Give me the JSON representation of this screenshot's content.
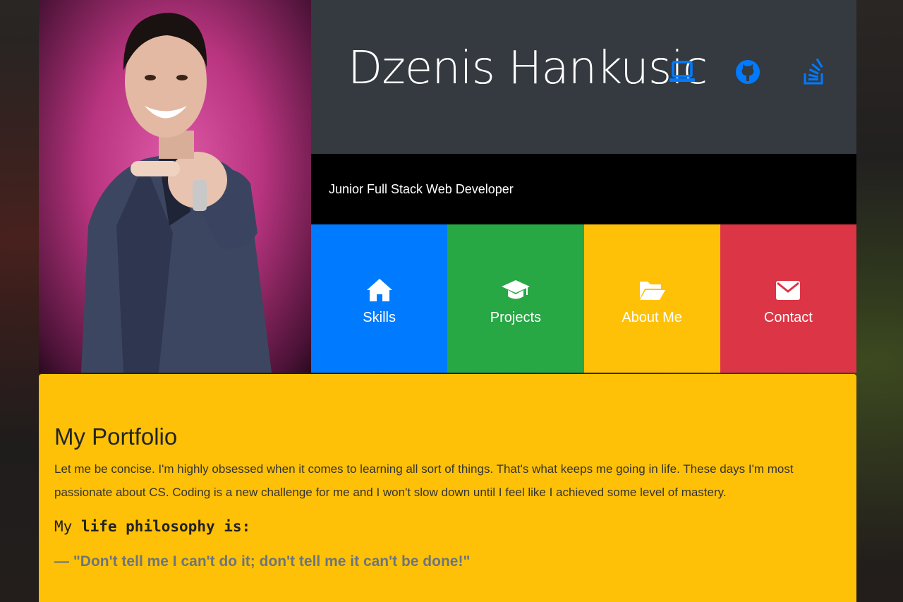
{
  "header": {
    "name": "Dzenis Hankusic",
    "subtitle": "Junior Full Stack Web Developer",
    "social": [
      {
        "icon": "laptop-icon"
      },
      {
        "icon": "github-icon"
      },
      {
        "icon": "stackoverflow-icon"
      }
    ],
    "social_color": "#007bff"
  },
  "nav": {
    "tiles": [
      {
        "label": "Skills",
        "icon": "home-icon",
        "color": "#007bff"
      },
      {
        "label": "Projects",
        "icon": "graduation-cap-icon",
        "color": "#28a745"
      },
      {
        "label": "About Me",
        "icon": "folder-open-icon",
        "color": "#ffc107"
      },
      {
        "label": "Contact",
        "icon": "envelope-icon",
        "color": "#dc3545"
      }
    ]
  },
  "content": {
    "title": "My Portfolio",
    "description": "Let me be concise. I'm highly obsessed when it comes to learning all sort of things. That's what keeps me going in life. These days I'm most passionate about CS. Coding is a new challenge for me and I won't slow down until I feel like I achieved some level of mastery.",
    "philosophy_prefix": "My",
    "philosophy_rest": "life philosophy is:",
    "quote": "— \"Don't tell me I can't do it; don't tell me it can't be done!\""
  }
}
